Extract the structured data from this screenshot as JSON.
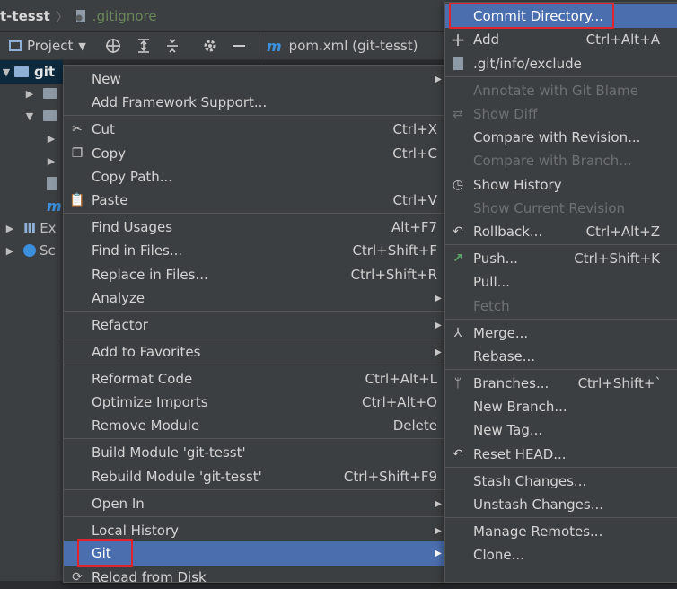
{
  "ide": {
    "breadcrumb": {
      "project": "t-tesst",
      "file": ".gitignore"
    },
    "toolbar": {
      "project_label": "Project",
      "tab_label": "pom.xml (git-tesst)",
      "tab_icon_glyph": "m"
    },
    "tree": {
      "root": "git",
      "items": [
        "Ex",
        "Sc"
      ]
    }
  },
  "main_menu": {
    "items": [
      {
        "label": "New",
        "shortcut": "",
        "submenu": true
      },
      {
        "label": "Add Framework Support...",
        "shortcut": ""
      },
      {
        "label": "Cut",
        "shortcut": "Ctrl+X",
        "icon": "cut-icon"
      },
      {
        "label": "Copy",
        "shortcut": "Ctrl+C",
        "icon": "copy-icon"
      },
      {
        "label": "Copy Path...",
        "shortcut": ""
      },
      {
        "label": "Paste",
        "shortcut": "Ctrl+V",
        "icon": "paste-icon"
      },
      {
        "label": "Find Usages",
        "shortcut": "Alt+F7"
      },
      {
        "label": "Find in Files...",
        "shortcut": "Ctrl+Shift+F"
      },
      {
        "label": "Replace in Files...",
        "shortcut": "Ctrl+Shift+R"
      },
      {
        "label": "Analyze",
        "shortcut": "",
        "submenu": true
      },
      {
        "label": "Refactor",
        "shortcut": "",
        "submenu": true
      },
      {
        "label": "Add to Favorites",
        "shortcut": "",
        "submenu": true
      },
      {
        "label": "Reformat Code",
        "shortcut": "Ctrl+Alt+L"
      },
      {
        "label": "Optimize Imports",
        "shortcut": "Ctrl+Alt+O"
      },
      {
        "label": "Remove Module",
        "shortcut": "Delete"
      },
      {
        "label": "Build Module 'git-tesst'",
        "shortcut": ""
      },
      {
        "label": "Rebuild Module 'git-tesst'",
        "shortcut": "Ctrl+Shift+F9"
      },
      {
        "label": "Open In",
        "shortcut": "",
        "submenu": true
      },
      {
        "label": "Local History",
        "shortcut": "",
        "submenu": true
      },
      {
        "label": "Git",
        "shortcut": "",
        "submenu": true,
        "active": true
      },
      {
        "label": "Reload from Disk",
        "shortcut": "",
        "icon": "reload-icon"
      }
    ]
  },
  "git_menu": {
    "items": [
      {
        "label": "Commit Directory...",
        "shortcut": "",
        "active": true
      },
      {
        "label": "Add",
        "shortcut": "Ctrl+Alt+A",
        "icon": "plus-icon"
      },
      {
        "label": ".git/info/exclude",
        "shortcut": "",
        "icon": "file-icon"
      },
      {
        "label": "Annotate with Git Blame",
        "shortcut": "",
        "disabled": true
      },
      {
        "label": "Show Diff",
        "shortcut": "",
        "disabled": true,
        "icon": "diff-icon"
      },
      {
        "label": "Compare with Revision...",
        "shortcut": ""
      },
      {
        "label": "Compare with Branch...",
        "shortcut": "",
        "disabled": true
      },
      {
        "label": "Show History",
        "shortcut": "",
        "icon": "history-icon"
      },
      {
        "label": "Show Current Revision",
        "shortcut": "",
        "disabled": true
      },
      {
        "label": "Rollback...",
        "shortcut": "Ctrl+Alt+Z",
        "icon": "rollback-icon"
      },
      {
        "label": "Push...",
        "shortcut": "Ctrl+Shift+K",
        "icon": "push-arrow-icon"
      },
      {
        "label": "Pull...",
        "shortcut": ""
      },
      {
        "label": "Fetch",
        "shortcut": "",
        "disabled": true
      },
      {
        "label": "Merge...",
        "shortcut": "",
        "icon": "merge-icon"
      },
      {
        "label": "Rebase...",
        "shortcut": ""
      },
      {
        "label": "Branches...",
        "shortcut": "Ctrl+Shift+`",
        "icon": "branch-icon"
      },
      {
        "label": "New Branch...",
        "shortcut": ""
      },
      {
        "label": "New Tag...",
        "shortcut": ""
      },
      {
        "label": "Reset HEAD...",
        "shortcut": "",
        "icon": "reset-icon"
      },
      {
        "label": "Stash Changes...",
        "shortcut": ""
      },
      {
        "label": "Unstash Changes...",
        "shortcut": ""
      },
      {
        "label": "Manage Remotes...",
        "shortcut": ""
      },
      {
        "label": "Clone...",
        "shortcut": ""
      }
    ]
  },
  "colors": {
    "menu_bg": "#3c3f41",
    "highlight": "#4b6eaf",
    "disabled_text": "#6e7173",
    "annotation_red": "#e0242c",
    "push_green": "#59a869"
  }
}
